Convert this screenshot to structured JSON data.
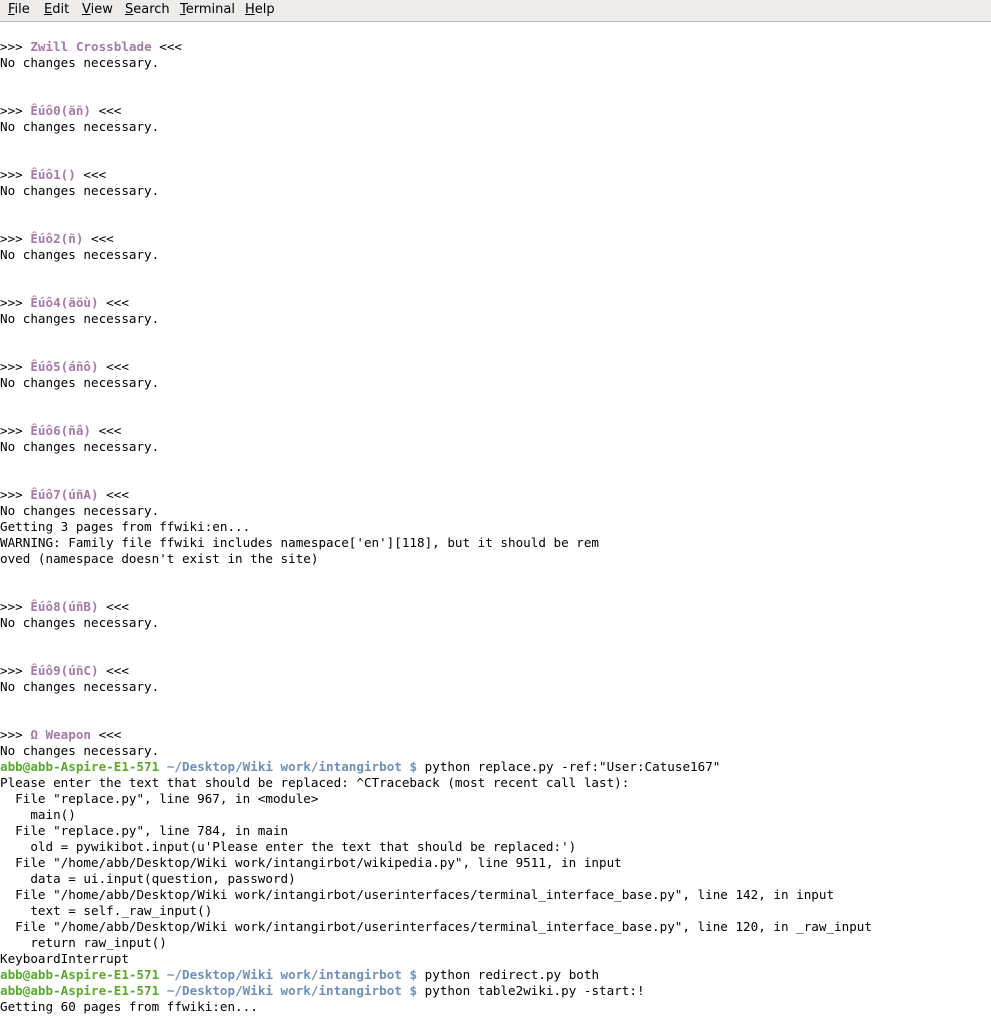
{
  "menu": [
    {
      "pre": "",
      "mn": "F",
      "rest": "ile"
    },
    {
      "pre": "",
      "mn": "E",
      "rest": "dit"
    },
    {
      "pre": "",
      "mn": "V",
      "rest": "iew"
    },
    {
      "pre": "",
      "mn": "S",
      "rest": "earch"
    },
    {
      "pre": "",
      "mn": "T",
      "rest": "erminal"
    },
    {
      "pre": "",
      "mn": "H",
      "rest": "elp"
    }
  ],
  "prompt": {
    "user_host": "abb@abb-Aspire-E1-571",
    "path": "~/Desktop/Wiki work/intangirbot",
    "symbol": "$"
  },
  "lines": [
    {
      "t": "blank"
    },
    {
      "t": "header",
      "name": "Zwill Crossblade"
    },
    {
      "t": "text",
      "text": "No changes necessary."
    },
    {
      "t": "blank"
    },
    {
      "t": "blank"
    },
    {
      "t": "header",
      "name": "Êúô0(äñ)"
    },
    {
      "t": "text",
      "text": "No changes necessary."
    },
    {
      "t": "blank"
    },
    {
      "t": "blank"
    },
    {
      "t": "header",
      "name": "Êúô1()"
    },
    {
      "t": "text",
      "text": "No changes necessary."
    },
    {
      "t": "blank"
    },
    {
      "t": "blank"
    },
    {
      "t": "header",
      "name": "Êúô2(ñ)"
    },
    {
      "t": "text",
      "text": "No changes necessary."
    },
    {
      "t": "blank"
    },
    {
      "t": "blank"
    },
    {
      "t": "header",
      "name": "Êúô4(äöù)"
    },
    {
      "t": "text",
      "text": "No changes necessary."
    },
    {
      "t": "blank"
    },
    {
      "t": "blank"
    },
    {
      "t": "header",
      "name": "Êúô5(áñô)"
    },
    {
      "t": "text",
      "text": "No changes necessary."
    },
    {
      "t": "blank"
    },
    {
      "t": "blank"
    },
    {
      "t": "header",
      "name": "Êúô6(ñâ)"
    },
    {
      "t": "text",
      "text": "No changes necessary."
    },
    {
      "t": "blank"
    },
    {
      "t": "blank"
    },
    {
      "t": "header",
      "name": "Êúô7(úñA)"
    },
    {
      "t": "text",
      "text": "No changes necessary."
    },
    {
      "t": "text",
      "text": "Getting 3 pages from ffwiki:en..."
    },
    {
      "t": "text",
      "text": "WARNING: Family file ffwiki includes namespace['en'][118], but it should be rem"
    },
    {
      "t": "text",
      "text": "oved (namespace doesn't exist in the site)"
    },
    {
      "t": "blank"
    },
    {
      "t": "blank"
    },
    {
      "t": "header",
      "name": "Êúô8(úñB)"
    },
    {
      "t": "text",
      "text": "No changes necessary."
    },
    {
      "t": "blank"
    },
    {
      "t": "blank"
    },
    {
      "t": "header",
      "name": "Êúô9(úñC)"
    },
    {
      "t": "text",
      "text": "No changes necessary."
    },
    {
      "t": "blank"
    },
    {
      "t": "blank"
    },
    {
      "t": "header",
      "name": "Ω Weapon"
    },
    {
      "t": "text",
      "text": "No changes necessary."
    },
    {
      "t": "prompt",
      "cmd": "python replace.py -ref:\"User:Catuse167\""
    },
    {
      "t": "text",
      "text": "Please enter the text that should be replaced: ^CTraceback (most recent call last):"
    },
    {
      "t": "text",
      "text": "  File \"replace.py\", line 967, in <module>"
    },
    {
      "t": "text",
      "text": "    main()"
    },
    {
      "t": "text",
      "text": "  File \"replace.py\", line 784, in main"
    },
    {
      "t": "text",
      "text": "    old = pywikibot.input(u'Please enter the text that should be replaced:')"
    },
    {
      "t": "text",
      "text": "  File \"/home/abb/Desktop/Wiki work/intangirbot/wikipedia.py\", line 9511, in input"
    },
    {
      "t": "text",
      "text": "    data = ui.input(question, password)"
    },
    {
      "t": "text",
      "text": "  File \"/home/abb/Desktop/Wiki work/intangirbot/userinterfaces/terminal_interface_base.py\", line 142, in input"
    },
    {
      "t": "text",
      "text": "    text = self._raw_input()"
    },
    {
      "t": "text",
      "text": "  File \"/home/abb/Desktop/Wiki work/intangirbot/userinterfaces/terminal_interface_base.py\", line 120, in _raw_input"
    },
    {
      "t": "text",
      "text": "    return raw_input()"
    },
    {
      "t": "text",
      "text": "KeyboardInterrupt"
    },
    {
      "t": "prompt",
      "cmd": "python redirect.py both"
    },
    {
      "t": "prompt",
      "cmd": "python table2wiki.py -start:!"
    },
    {
      "t": "text",
      "text": "Getting 60 pages from ffwiki:en..."
    }
  ]
}
